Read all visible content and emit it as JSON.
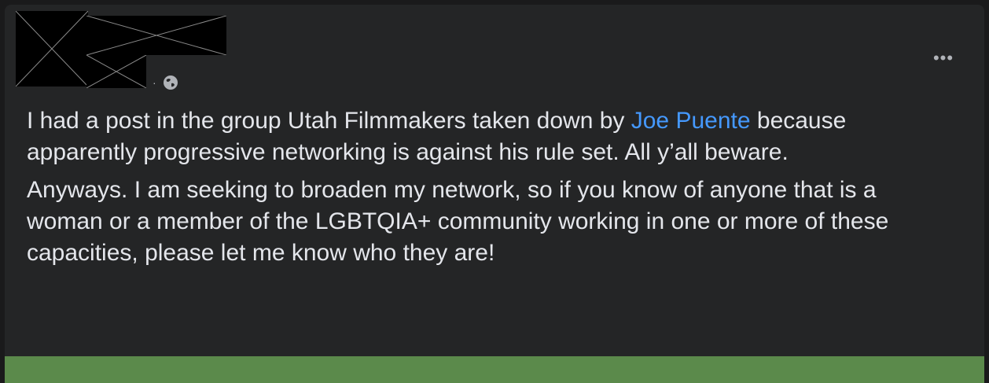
{
  "post": {
    "paragraph1_before_mention": "I had a post in the group Utah Filmmakers taken down by ",
    "mention": "Joe Puente",
    "paragraph1_after_mention": " because apparently progressive networking is against his rule set. All y’all beware.",
    "paragraph2": "Anyways. I am seeking to broaden my network, so if you know of anyone that is a woman or a member of the LGBTQIA+ community working in one or more of these capacities, please let me know who they are!",
    "meta_separator": "·",
    "more_label": "•••"
  },
  "icons": {
    "privacy": "globe-icon",
    "more": "more-options-icon"
  },
  "colors": {
    "card_bg": "#242526",
    "text": "#e4e6eb",
    "mention": "#4599ff",
    "strip": "#5b8a4b"
  }
}
